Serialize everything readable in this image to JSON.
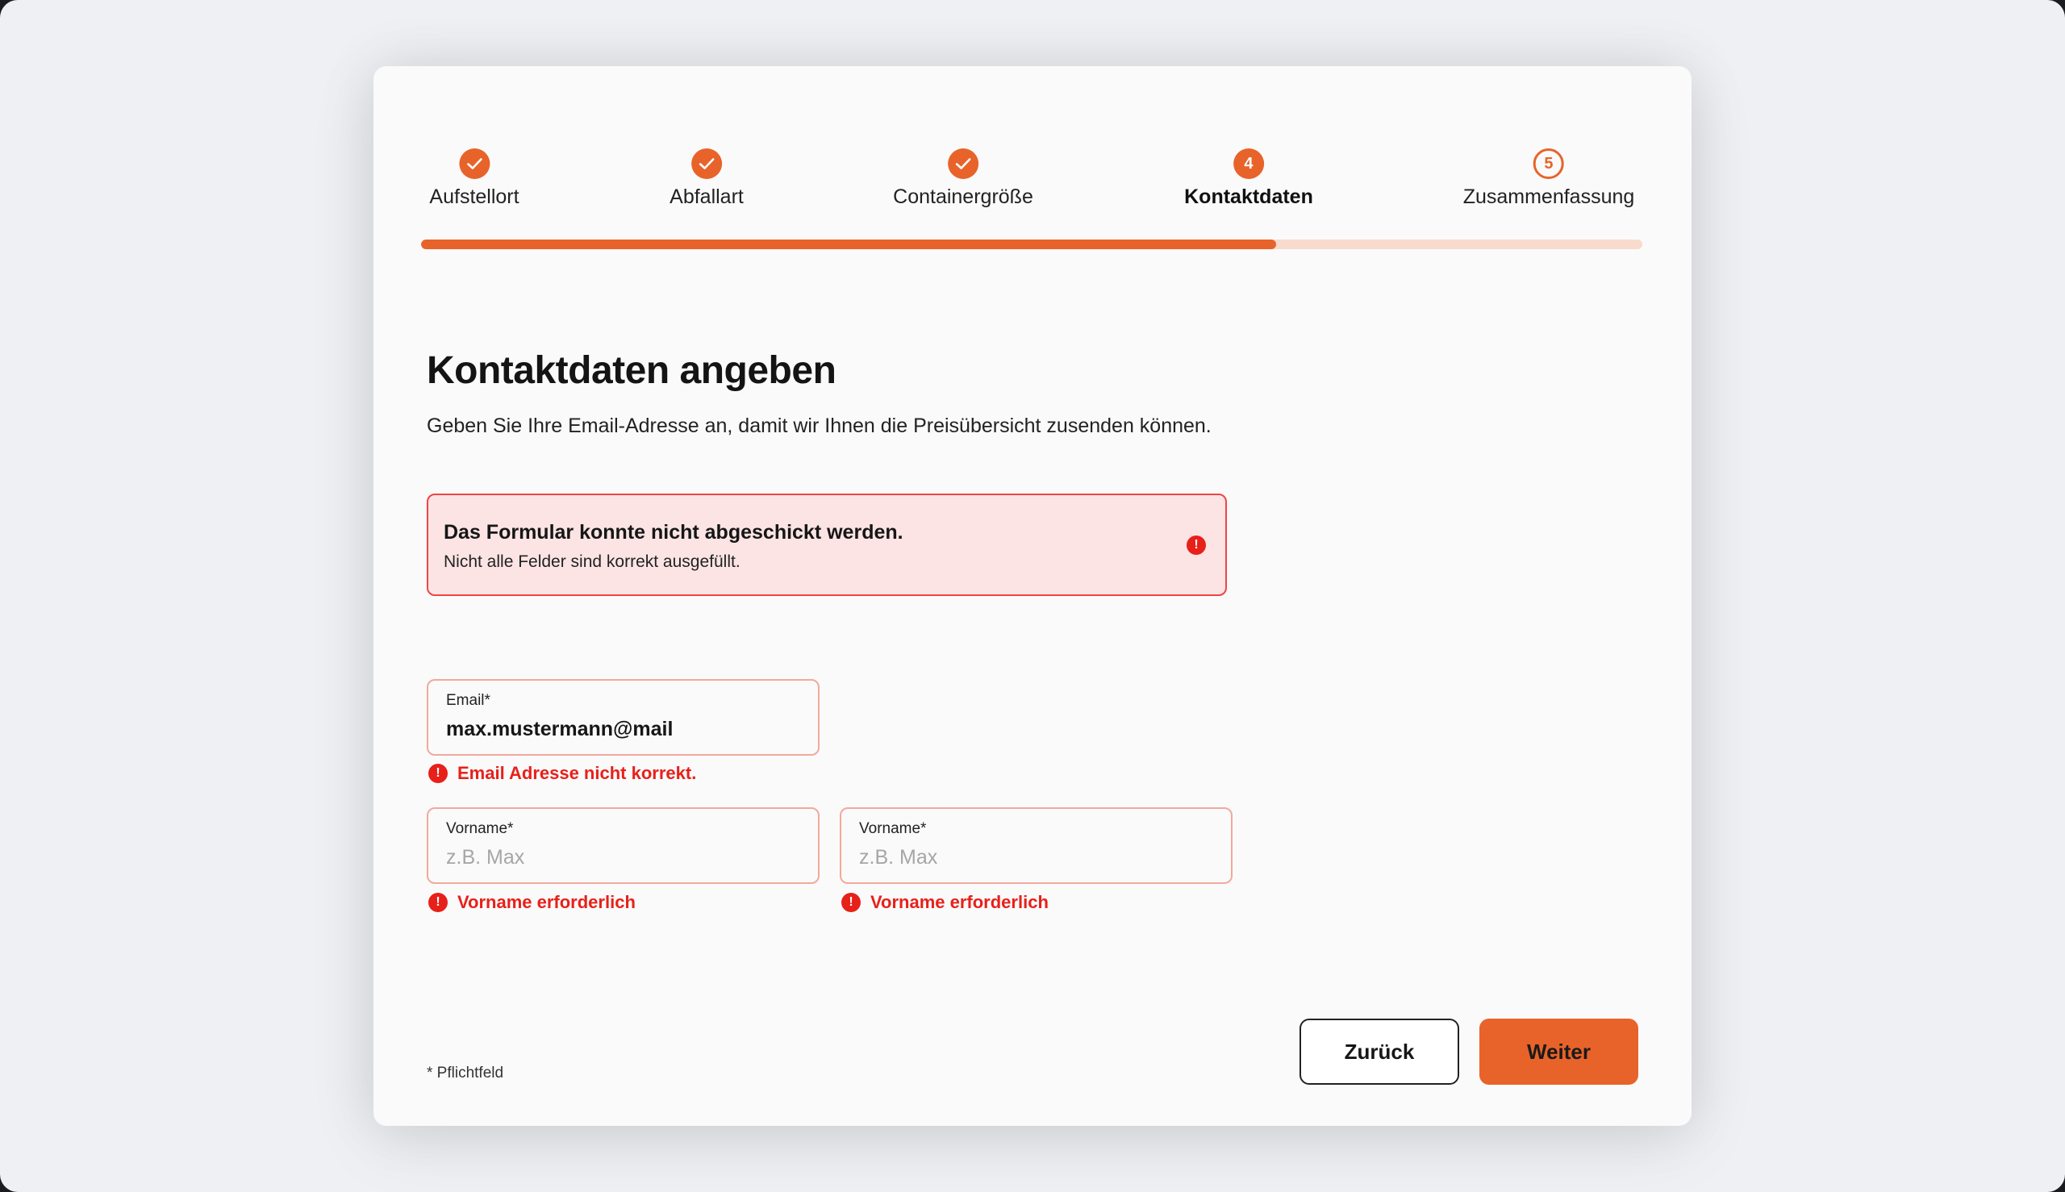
{
  "stepper": {
    "steps": [
      {
        "label": "Aufstellort",
        "state": "done",
        "icon": "check-icon"
      },
      {
        "label": "Abfallart",
        "state": "done",
        "icon": "check-icon"
      },
      {
        "label": "Containergröße",
        "state": "done",
        "icon": "check-icon"
      },
      {
        "label": "Kontaktdaten",
        "state": "active",
        "number": "4"
      },
      {
        "label": "Zusammenfassung",
        "state": "todo",
        "number": "5"
      }
    ],
    "progress_percent": 70
  },
  "page": {
    "title": "Kontaktdaten angeben",
    "subtitle": "Geben Sie Ihre Email-Adresse an, damit wir Ihnen die Preisübersicht zusenden können."
  },
  "error_banner": {
    "title": "Das Formular konnte nicht abgeschickt werden.",
    "text": "Nicht alle Felder sind korrekt ausgefüllt.",
    "icon": "alert-icon",
    "icon_glyph": "!"
  },
  "form": {
    "email": {
      "label": "Email*",
      "value": "max.mustermann@mail",
      "error": "Email Adresse nicht korrekt."
    },
    "firstname_1": {
      "label": "Vorname*",
      "placeholder": "z.B. Max",
      "error": "Vorname erforderlich"
    },
    "firstname_2": {
      "label": "Vorname*",
      "placeholder": "z.B. Max",
      "error": "Vorname erforderlich"
    }
  },
  "footer": {
    "required_note": "* Pflichtfeld",
    "back_label": "Zurück",
    "next_label": "Weiter"
  },
  "colors": {
    "accent": "#e8632a",
    "progress_track": "#f8dbcd",
    "error": "#e8201a",
    "error_banner_bg": "#fce4e4"
  }
}
